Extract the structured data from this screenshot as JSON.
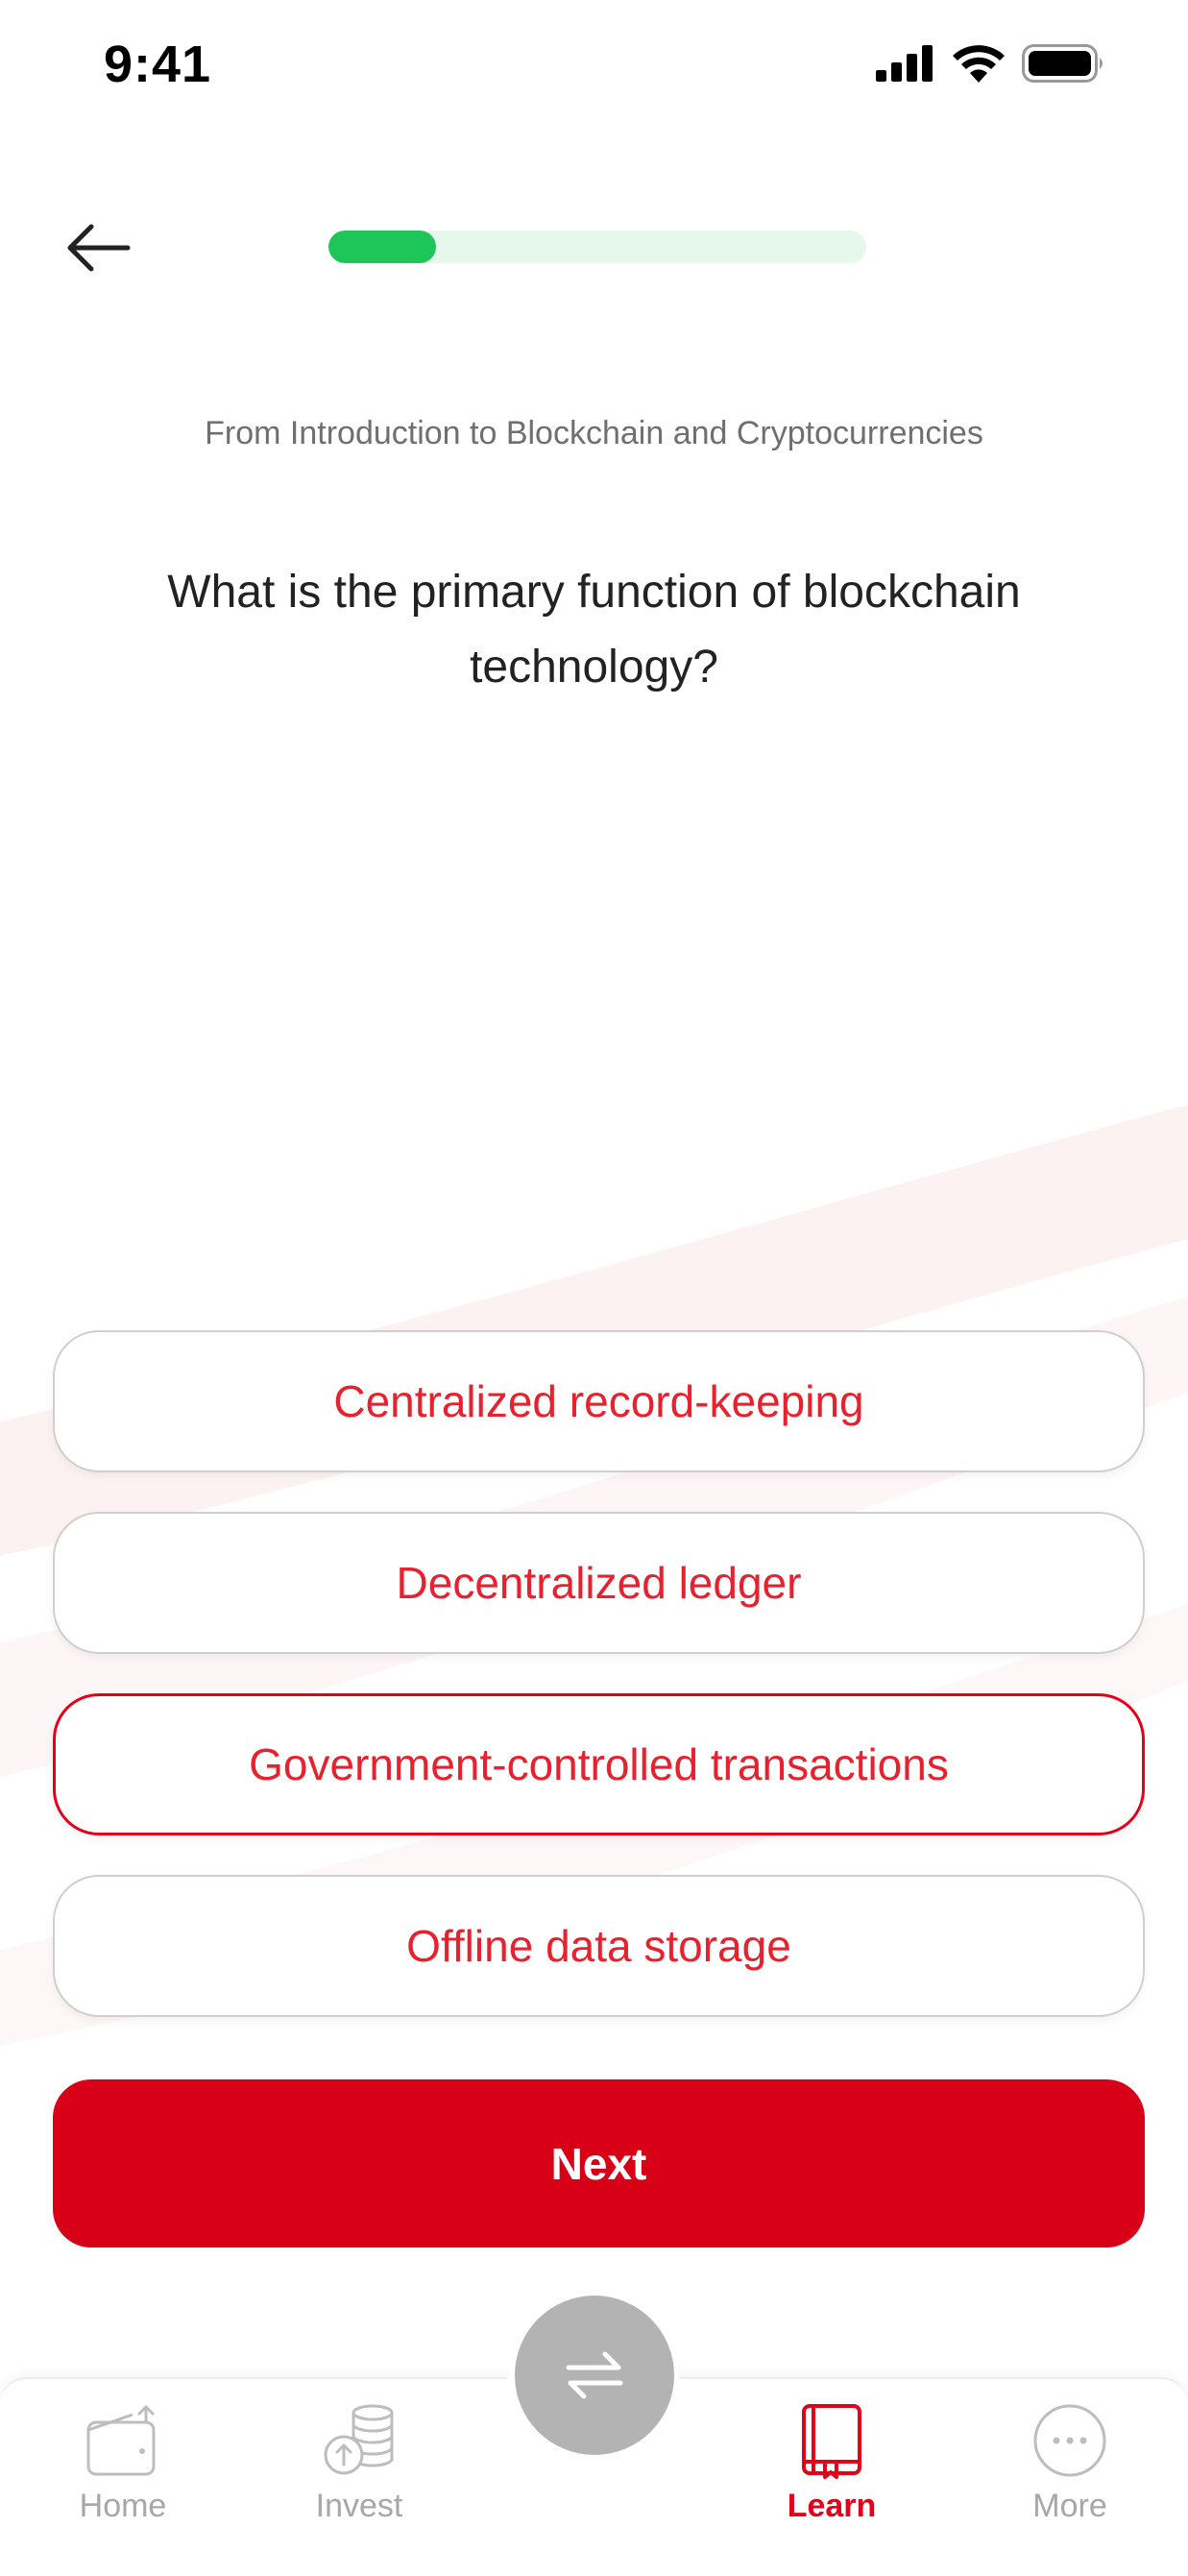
{
  "status_bar": {
    "time": "9:41",
    "icons": [
      "cellular-signal-icon",
      "wifi-icon",
      "battery-icon"
    ]
  },
  "header": {
    "back_icon": "arrow-left-icon",
    "progress_fraction": 0.2
  },
  "quiz": {
    "source": "From Introduction to Blockchain and Cryptocurrencies",
    "question": "What is the primary function of blockchain technology?",
    "options": [
      {
        "label": "Centralized record-keeping",
        "selected": false
      },
      {
        "label": "Decentralized ledger",
        "selected": false
      },
      {
        "label": "Government-controlled transactions",
        "selected": true
      },
      {
        "label": "Offline data storage",
        "selected": false
      }
    ],
    "next_label": "Next"
  },
  "bottom_nav": {
    "fab_icon": "swap-arrows-icon",
    "items": [
      {
        "label": "Home",
        "icon": "wallet-icon",
        "active": false
      },
      {
        "label": "Invest",
        "icon": "coins-icon",
        "active": false
      },
      {
        "label": "Learn",
        "icon": "book-icon",
        "active": true
      },
      {
        "label": "More",
        "icon": "more-dots-icon",
        "active": false
      }
    ]
  },
  "colors": {
    "accent_red": "#d80016",
    "option_text": "#e8212f",
    "progress_green": "#1ec559",
    "progress_track": "#e6f8ec",
    "inactive_gray": "#a7a7a7"
  }
}
